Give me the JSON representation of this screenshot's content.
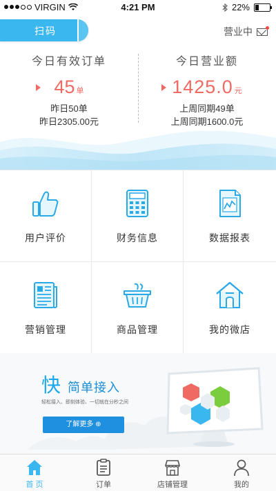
{
  "status_bar": {
    "carrier": "VIRGIN",
    "time": "4:21 PM",
    "battery": "22%"
  },
  "header": {
    "scan_label": "扫码",
    "business_status": "营业中"
  },
  "stats": {
    "orders": {
      "title": "今日有效订单",
      "value": "45",
      "unit": "单",
      "yesterday": "昨日50单",
      "yesterday_amount": "昨日2305.00元"
    },
    "revenue": {
      "title": "今日营业额",
      "value": "1425.0",
      "unit": "元",
      "last_week": "上周同期49单",
      "last_week_amount": "上周同期1600.0元"
    }
  },
  "grid": {
    "items": [
      {
        "label": "用户评价",
        "icon": "thumbs-up-icon"
      },
      {
        "label": "财务信息",
        "icon": "calculator-icon"
      },
      {
        "label": "数据报表",
        "icon": "report-chart-icon"
      },
      {
        "label": "营销管理",
        "icon": "newspaper-icon"
      },
      {
        "label": "商品管理",
        "icon": "basket-icon"
      },
      {
        "label": "我的微店",
        "icon": "shop-house-icon"
      }
    ]
  },
  "banner": {
    "big_char": "快",
    "headline": "简单接入",
    "tagline": "轻松接入、即刻体验、一切就在分秒之间",
    "button_label": "了解更多 ⊕"
  },
  "tabbar": {
    "items": [
      {
        "label": "首 页",
        "icon": "home-icon",
        "active": true
      },
      {
        "label": "订单",
        "icon": "clipboard-icon",
        "active": false
      },
      {
        "label": "店铺管理",
        "icon": "store-icon",
        "active": false
      },
      {
        "label": "我的",
        "icon": "person-icon",
        "active": false
      }
    ]
  },
  "colors": {
    "accent": "#3bb7ef",
    "highlight": "#f06a64"
  }
}
